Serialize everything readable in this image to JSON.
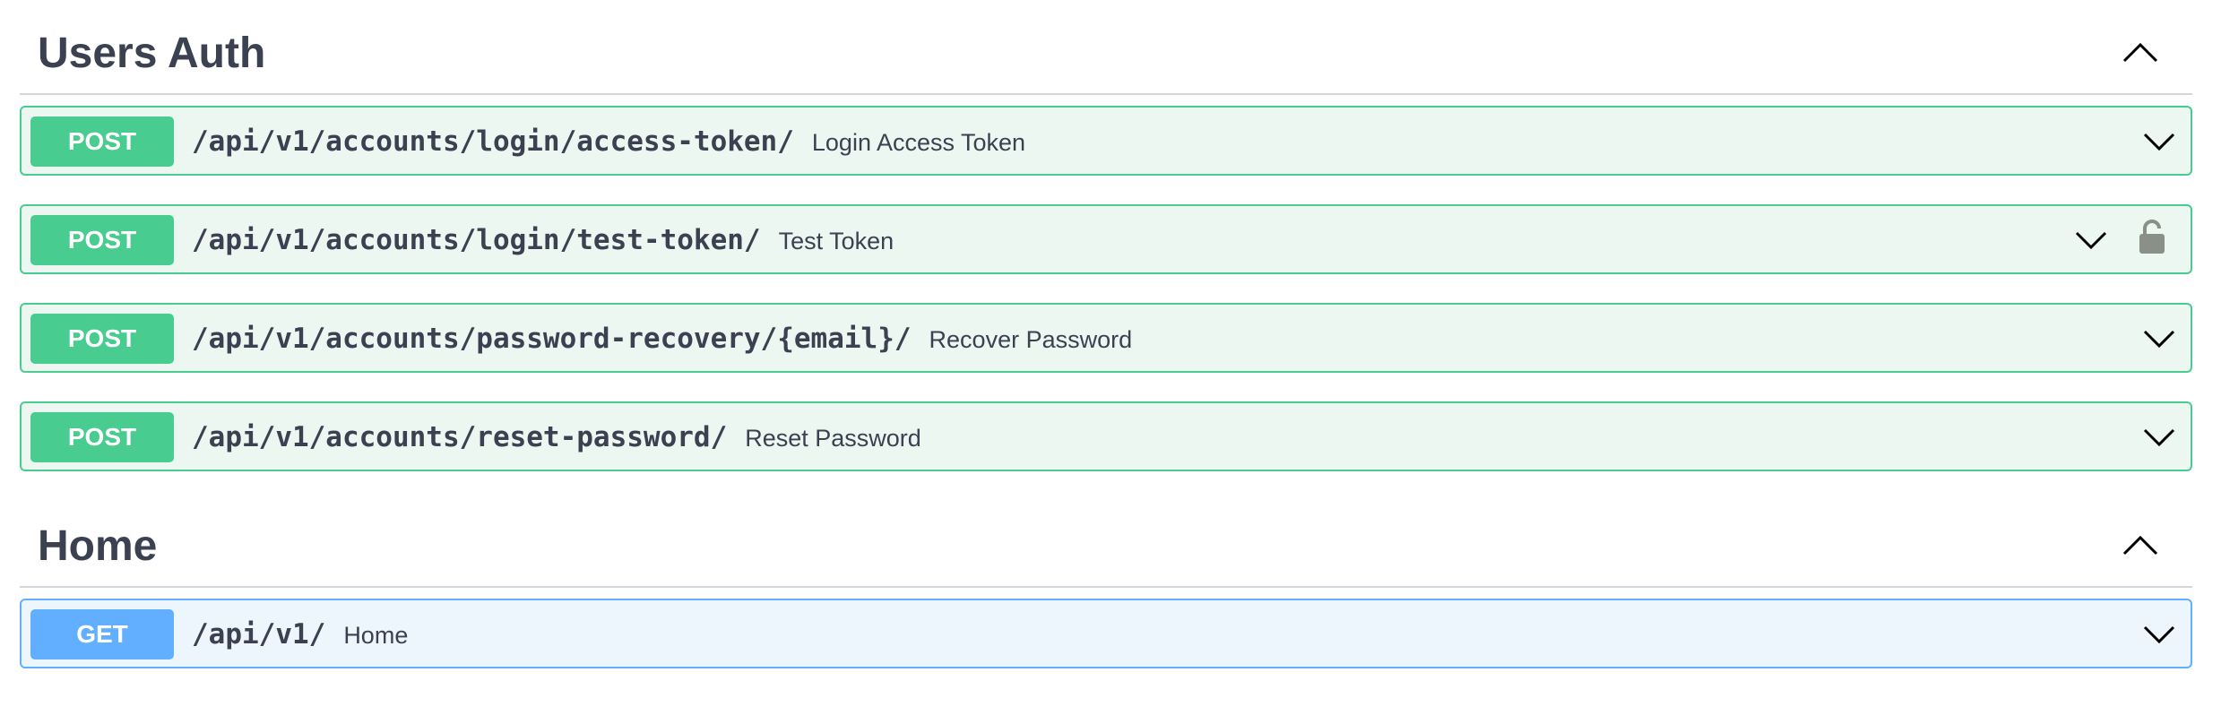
{
  "sections": [
    {
      "title": "Users Auth",
      "operations": [
        {
          "method": "POST",
          "path": "/api/v1/accounts/login/access-token/",
          "summary": "Login Access Token",
          "locked": false
        },
        {
          "method": "POST",
          "path": "/api/v1/accounts/login/test-token/",
          "summary": "Test Token",
          "locked": true
        },
        {
          "method": "POST",
          "path": "/api/v1/accounts/password-recovery/{email}/",
          "summary": "Recover Password",
          "locked": false
        },
        {
          "method": "POST",
          "path": "/api/v1/accounts/reset-password/",
          "summary": "Reset Password",
          "locked": false
        }
      ]
    },
    {
      "title": "Home",
      "operations": [
        {
          "method": "GET",
          "path": "/api/v1/",
          "summary": "Home",
          "locked": false
        }
      ]
    }
  ],
  "icons": {
    "collapse": "chevron-up-icon",
    "expand": "chevron-down-icon",
    "lock": "unlocked-padlock-icon"
  },
  "colors": {
    "post": "#49cc90",
    "post_bg": "#ecf7f1",
    "get": "#61affe",
    "get_bg": "#edf5fd",
    "text": "#3b4151",
    "lock": "#8a8f88"
  }
}
